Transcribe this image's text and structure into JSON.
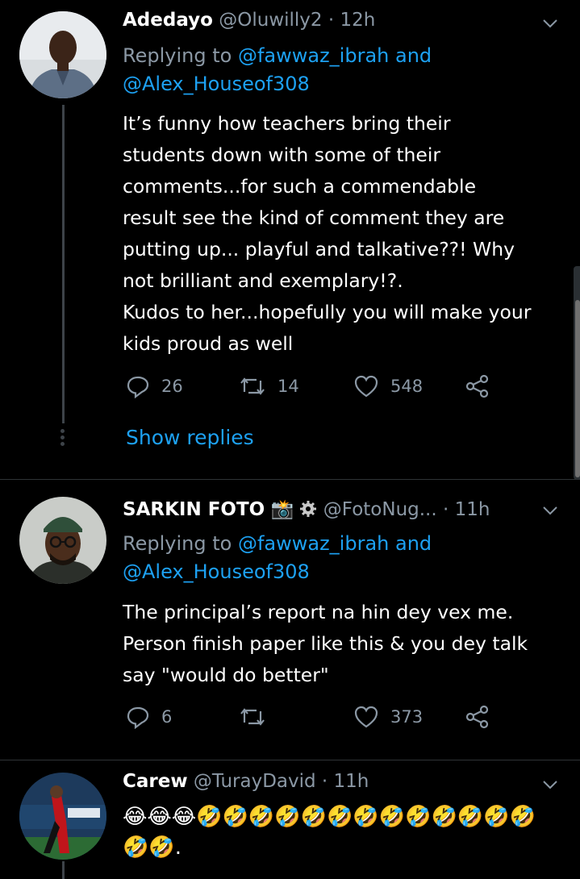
{
  "tweets": [
    {
      "name": "Adedayo",
      "handle": "@Oluwilly2",
      "time": "· 12h",
      "replying_prefix": "Replying to",
      "reply_user1": "@fawwaz_ibrah",
      "reply_and": "and",
      "reply_user2": "@Alex_Houseof308",
      "lines": [
        "It’s funny how teachers bring their",
        "students down with some of their",
        "comments...for such a commendable",
        "result see the kind of comment they are",
        "putting up... playful and talkative??! Why",
        "not brilliant and exemplary!?.",
        "Kudos to her...hopefully you will make your",
        "kids proud as well"
      ],
      "replies": "26",
      "retweets": "14",
      "likes": "548",
      "show_replies": "Show replies"
    },
    {
      "name": "SARKIN FOTO",
      "handle": "@FotoNug...",
      "time": "· 11h",
      "replying_prefix": "Replying to",
      "reply_user1": "@fawwaz_ibrah",
      "reply_and": "and",
      "reply_user2": "@Alex_Houseof308",
      "lines": [
        "The principal’s report na hin dey vex me.",
        "Person finish paper like this & you dey talk",
        "say \"would do better\""
      ],
      "replies": "6",
      "retweets": "",
      "likes": "373"
    },
    {
      "name": "Carew",
      "handle": "@TurayDavid",
      "time": "· 11h",
      "emoji_line1": "😂😂😂🤣🤣🤣🤣🤣🤣🤣🤣🤣🤣🤣🤣🤣",
      "emoji_line2": "🤣🤣."
    }
  ],
  "colors": {
    "background": "#000000",
    "link": "#1da1f2",
    "muted": "#8b98a5",
    "line": "#3d4349"
  }
}
